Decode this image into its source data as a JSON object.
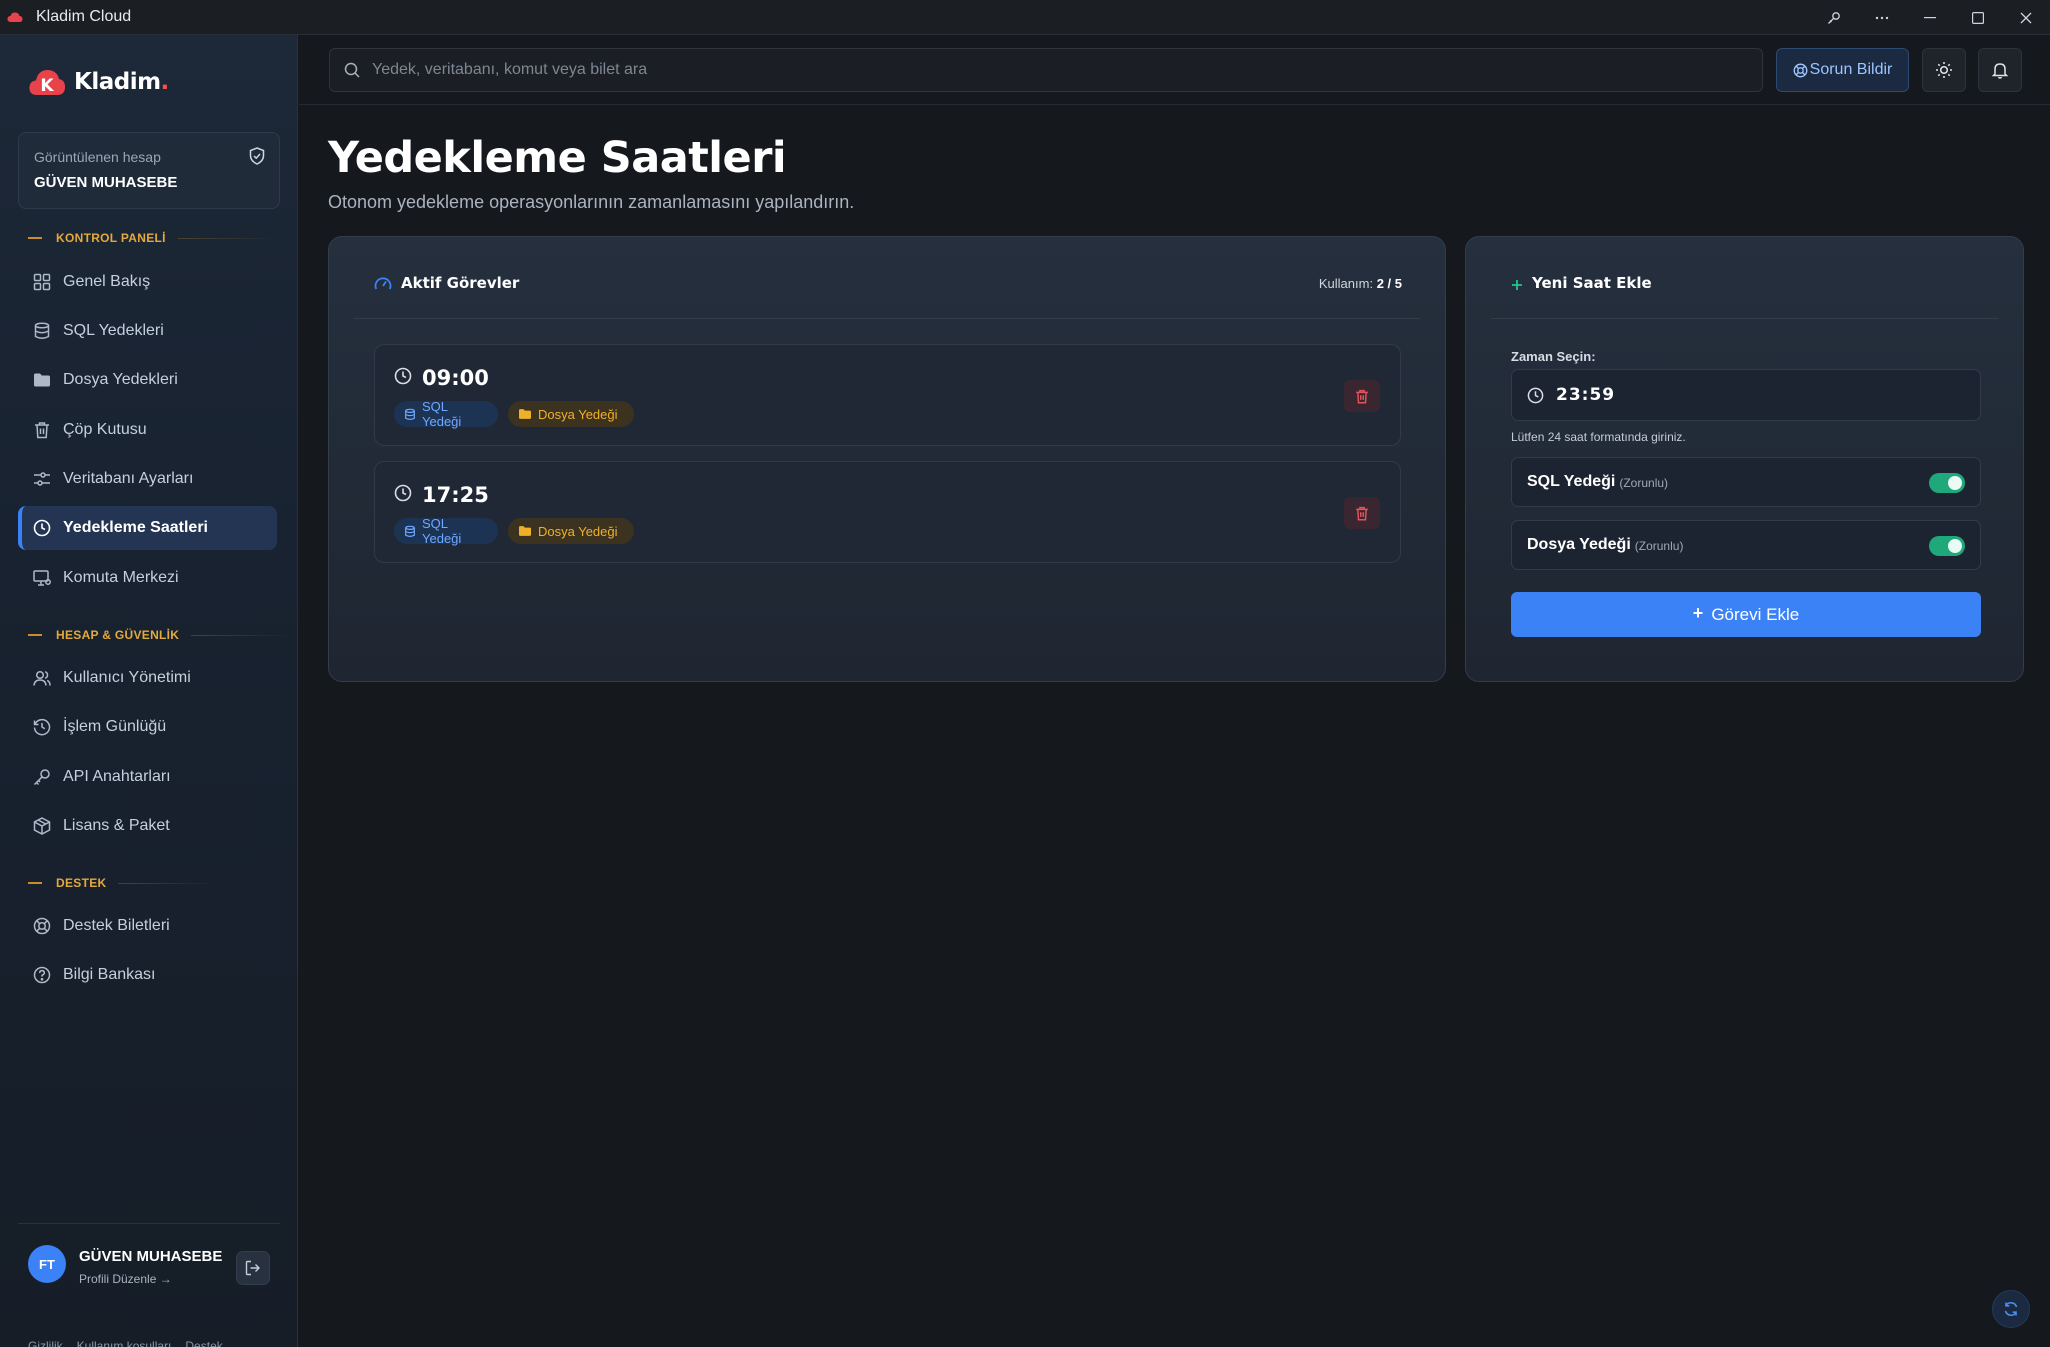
{
  "window": {
    "title": "Kladim Cloud"
  },
  "brand": {
    "name": "Kladim",
    "dot": "."
  },
  "account": {
    "label": "Görüntülenen hesap",
    "name": "GÜVEN MUHASEBE"
  },
  "sections": {
    "control": "KONTROL PANELİ",
    "security": "HESAP & GÜVENLİK",
    "support": "DESTEK"
  },
  "nav": {
    "overview": "Genel Bakış",
    "sql": "SQL Yedekleri",
    "files": "Dosya Yedekleri",
    "trash": "Çöp Kutusu",
    "db_settings": "Veritabanı Ayarları",
    "schedules": "Yedekleme Saatleri",
    "command": "Komuta Merkezi",
    "users": "Kullanıcı Yönetimi",
    "logs": "İşlem Günlüğü",
    "api_keys": "API Anahtarları",
    "license": "Lisans & Paket",
    "tickets": "Destek Biletleri",
    "kb": "Bilgi Bankası"
  },
  "user": {
    "initials": "FT",
    "name": "GÜVEN MUHASEBE",
    "edit": "Profili Düzenle →"
  },
  "footer": {
    "privacy": "Gizlilik",
    "terms": "Kullanım koşulları",
    "support": "Destek"
  },
  "topbar": {
    "search_placeholder": "Yedek, veritabanı, komut veya bilet ara",
    "report": "Sorun Bildir"
  },
  "page": {
    "title": "Yedekleme Saatleri",
    "subtitle": "Otonom yedekleme operasyonlarının zamanlamasını yapılandırın."
  },
  "active": {
    "title": "Aktif Görevler",
    "usage_label": "Kullanım:",
    "usage_value": "2 / 5",
    "tasks": [
      {
        "time": "09:00",
        "sql": "SQL Yedeği",
        "file": "Dosya Yedeği"
      },
      {
        "time": "17:25",
        "sql": "SQL Yedeği",
        "file": "Dosya Yedeği"
      }
    ]
  },
  "new_time": {
    "title": "Yeni Saat Ekle",
    "time_label": "Zaman Seçin:",
    "time_value": "23:59",
    "hint": "Lütfen 24 saat formatında giriniz.",
    "sql_label": "SQL Yedeği",
    "sql_req": "(Zorunlu)",
    "sql_on": true,
    "file_label": "Dosya Yedeği",
    "file_req": "(Zorunlu)",
    "file_on": true,
    "add_button": "Görevi Ekle"
  },
  "colors": {
    "accent": "#3b82f6",
    "section": "#e4a93c",
    "toggle": "#1fa97a",
    "brand": "#ff4d4d"
  }
}
